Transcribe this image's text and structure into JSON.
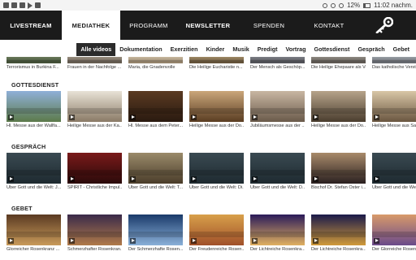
{
  "status": {
    "battery": "12%",
    "time": "11:02 nachm."
  },
  "nav": {
    "items": [
      "LIVESTREAM",
      "MEDIATHEK",
      "PROGRAMM",
      "NEWSLETTER",
      "SPENDEN",
      "KONTAKT"
    ],
    "active": "MEDIATHEK"
  },
  "filters": [
    "Alle videos",
    "Dokumentation",
    "Exerzitien",
    "Kinder",
    "Musik",
    "Predigt",
    "Vortrag",
    "Gottesdienst",
    "Gespräch",
    "Gebet"
  ],
  "top_row": {
    "captions": [
      "Terrorismus in Burkina F...",
      "Frauen in der Nachfolge ...",
      "Maria, die Gnadenvolle",
      "Die Heilige Eucharistie n...",
      "Der Mensch als Geschöp...",
      "Die Heilige Ehepaare als Vorb...",
      "Das katholische Verstä..."
    ]
  },
  "sections": [
    {
      "title": "GOTTESDIENST",
      "captions": [
        "Hl. Messe aus der Wallfa...",
        "Heilige Messe aus der Ka...",
        "Hl. Messe aus dem Peter...",
        "Heilige Messe aus der Do...",
        "Jubiläumsmesse aus der ...",
        "Heilige Messe aus der Do...",
        "Heilige Messe aus Santa..."
      ]
    },
    {
      "title": "GESPRÄCH",
      "captions": [
        "Über Gott und die Welt: J...",
        "SPIRIT - Christliche Impul...",
        "Über Gott und die Welt: T...",
        "Über Gott und die Welt: Di...",
        "Über Gott und die Welt: D...",
        "Bischof Dr. Stefan Oster i...",
        "Über Gott und die Welt: ..."
      ]
    },
    {
      "title": "GEBET",
      "captions": [
        "Glorreicher Rosenkranz ...",
        "Schmerzhafter Rosenkran...",
        "Der Schmerzhafte Rosen...",
        "Der Freudenreiche Rosen...",
        "Der Lichtreiche Rosenkra...",
        "Der Lichtreiche Rosenkra...",
        "Der Glorreiche Rosenkr..."
      ]
    }
  ],
  "colors": {
    "nav_bg": "#1b1b1b",
    "active_filter_bg": "#2b2b2b"
  }
}
